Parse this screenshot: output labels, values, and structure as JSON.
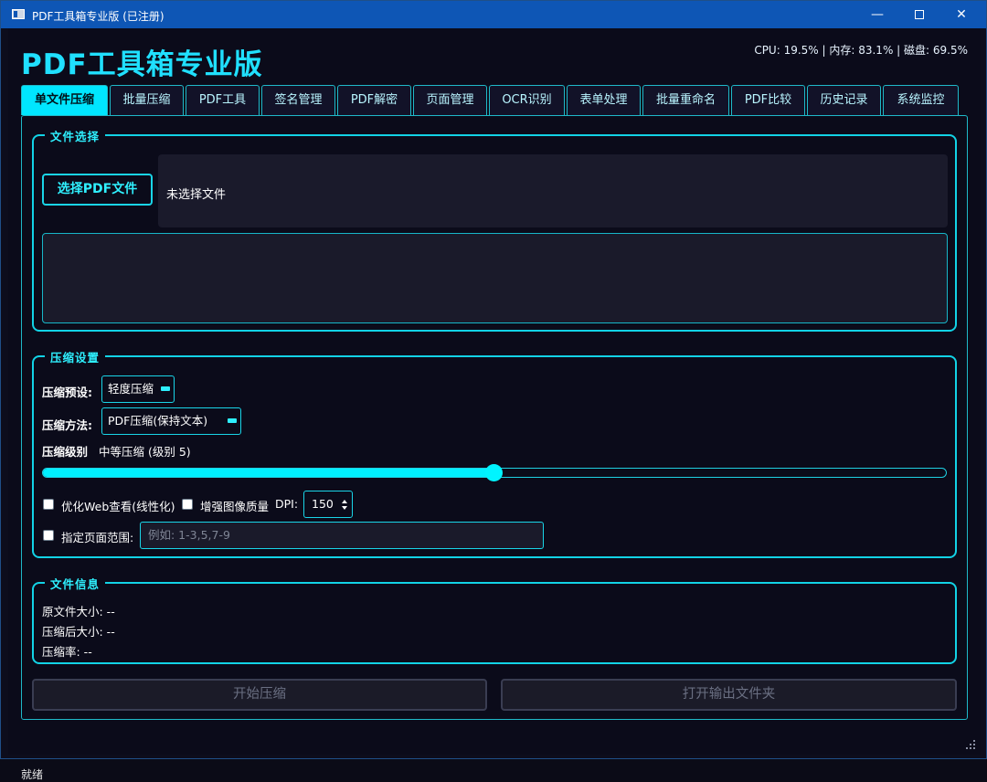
{
  "window": {
    "title": "PDF工具箱专业版 (已注册)",
    "controls": {
      "minimize": "—",
      "maximize": "",
      "close": "✕"
    }
  },
  "header": {
    "app_title": "PDF工具箱专业版",
    "system_stats": "CPU: 19.5% | 内存: 83.1% | 磁盘: 69.5%"
  },
  "tabs": [
    {
      "label": "单文件压缩",
      "active": true
    },
    {
      "label": "批量压缩",
      "active": false
    },
    {
      "label": "PDF工具",
      "active": false
    },
    {
      "label": "签名管理",
      "active": false
    },
    {
      "label": "PDF解密",
      "active": false
    },
    {
      "label": "页面管理",
      "active": false
    },
    {
      "label": "OCR识别",
      "active": false
    },
    {
      "label": "表单处理",
      "active": false
    },
    {
      "label": "批量重命名",
      "active": false
    },
    {
      "label": "PDF比较",
      "active": false
    },
    {
      "label": "历史记录",
      "active": false
    },
    {
      "label": "系统监控",
      "active": false
    }
  ],
  "file_select": {
    "group_title": "文件选择",
    "select_button": "选择PDF文件",
    "selected_label": "未选择文件"
  },
  "compress_settings": {
    "group_title": "压缩设置",
    "preset_label": "压缩预设:",
    "preset_value": "轻度压缩",
    "method_label": "压缩方法:",
    "method_value": "PDF压缩(保持文本)",
    "level_label": "压缩级别",
    "level_value_text": "中等压缩 (级别 5)",
    "level_fraction": 0.5,
    "optimize_web_label": "优化Web查看(线性化)",
    "optimize_web_checked": false,
    "enhance_image_label": "增强图像质量",
    "enhance_image_checked": false,
    "dpi_label": "DPI:",
    "dpi_value": "150",
    "page_range_label": "指定页面范围:",
    "page_range_checked": false,
    "page_range_placeholder": "例如: 1-3,5,7-9"
  },
  "file_info": {
    "group_title": "文件信息",
    "original_size": "原文件大小: --",
    "compressed_size": "压缩后大小: --",
    "ratio": "压缩率: --"
  },
  "actions": {
    "start_label": "开始压缩",
    "open_output_label": "打开输出文件夹"
  },
  "status_bar": "就绪",
  "colors": {
    "accent": "#00e6ff",
    "title_bar": "#0e56b5",
    "background": "#0b0b1a"
  }
}
